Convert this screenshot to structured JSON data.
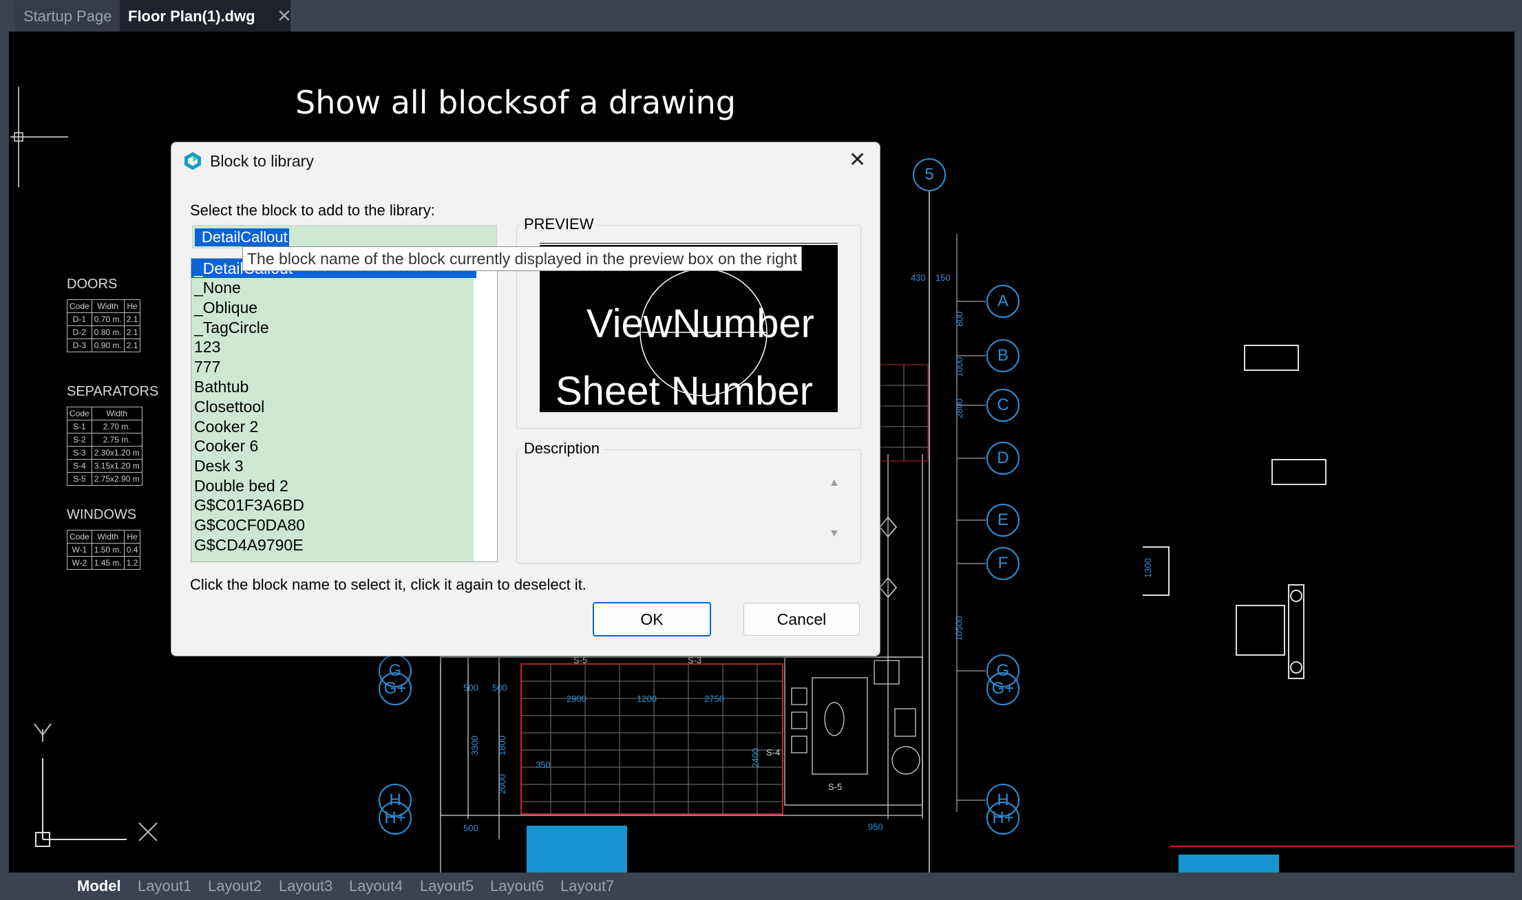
{
  "tabs": {
    "startup": "Startup Page",
    "active": "Floor Plan(1).dwg",
    "close_glyph": "✕"
  },
  "overlay_title": "Show all blocksof a drawing",
  "drawing": {
    "doors_title": "DOORS",
    "doors_headers": [
      "Code",
      "Width",
      "He"
    ],
    "doors_rows": [
      [
        "D-1",
        "0.70 m.",
        "2.1"
      ],
      [
        "D-2",
        "0.80 m.",
        "2.1"
      ],
      [
        "D-3",
        "0.90 m.",
        "2.1"
      ]
    ],
    "separators_title": "SEPARATORS",
    "separators_headers": [
      "Code",
      "Width"
    ],
    "separators_rows": [
      [
        "S-1",
        "2.70 m."
      ],
      [
        "S-2",
        "2.75 m."
      ],
      [
        "S-3",
        "2.30x1.20 m"
      ],
      [
        "S-4",
        "3.15x1.20 m"
      ],
      [
        "S-5",
        "2.75x2.90 m"
      ]
    ],
    "windows_title": "WINDOWS",
    "windows_headers": [
      "Code",
      "Width",
      "He"
    ],
    "windows_rows": [
      [
        "W-1",
        "1.50 m.",
        "0.4"
      ],
      [
        "W-2",
        "1.45 m.",
        "1.2"
      ]
    ],
    "grid_top": "5",
    "grid_right": [
      "A",
      "B",
      "C",
      "D",
      "E",
      "F",
      "G",
      "H"
    ],
    "grid_right_extra": [
      "G+",
      "H+"
    ],
    "grid_left": [
      "G",
      "G+",
      "H",
      "H+"
    ],
    "dims": [
      "430",
      "150",
      "800",
      "1000",
      "2800",
      "10500",
      "1300",
      "500",
      "500",
      "2900",
      "1200",
      "2750",
      "1800",
      "3300",
      "2000",
      "350",
      "2400",
      "500",
      "950",
      "S-4",
      "S-5",
      "S-3",
      "S-5"
    ],
    "axis_y": "Y",
    "axis_x": "X"
  },
  "dialog": {
    "title": "Block to library",
    "prompt": "Select the block to add to the library:",
    "selected_name": "DetailCallout",
    "items": [
      "_DetailCallout",
      "_None",
      "_Oblique",
      "_TagCircle",
      "123",
      "777",
      "Bathtub",
      "Closettool",
      "Cooker 2",
      "Cooker 6",
      "Desk 3",
      "Double bed 2",
      "G$C01F3A6BD",
      "G$C0CF0DA80",
      "G$CD4A9790E"
    ],
    "preview_label": "PREVIEW",
    "preview_line1": "ViewNumber",
    "preview_line2": "Sheet Number",
    "description_label": "Description",
    "hint": "Click the block name to select it, click it again to deselect it.",
    "ok": "OK",
    "cancel": "Cancel",
    "tooltip": "The block name of the block currently displayed in the preview box on the right"
  },
  "layouts": [
    "Model",
    "Layout1",
    "Layout2",
    "Layout3",
    "Layout4",
    "Layout5",
    "Layout6",
    "Layout7"
  ],
  "colors": {
    "accent": "#0a64d6",
    "list_bg": "#cde8d2",
    "grid_blue": "#2e8fd6",
    "wall_red": "#c0282d"
  }
}
